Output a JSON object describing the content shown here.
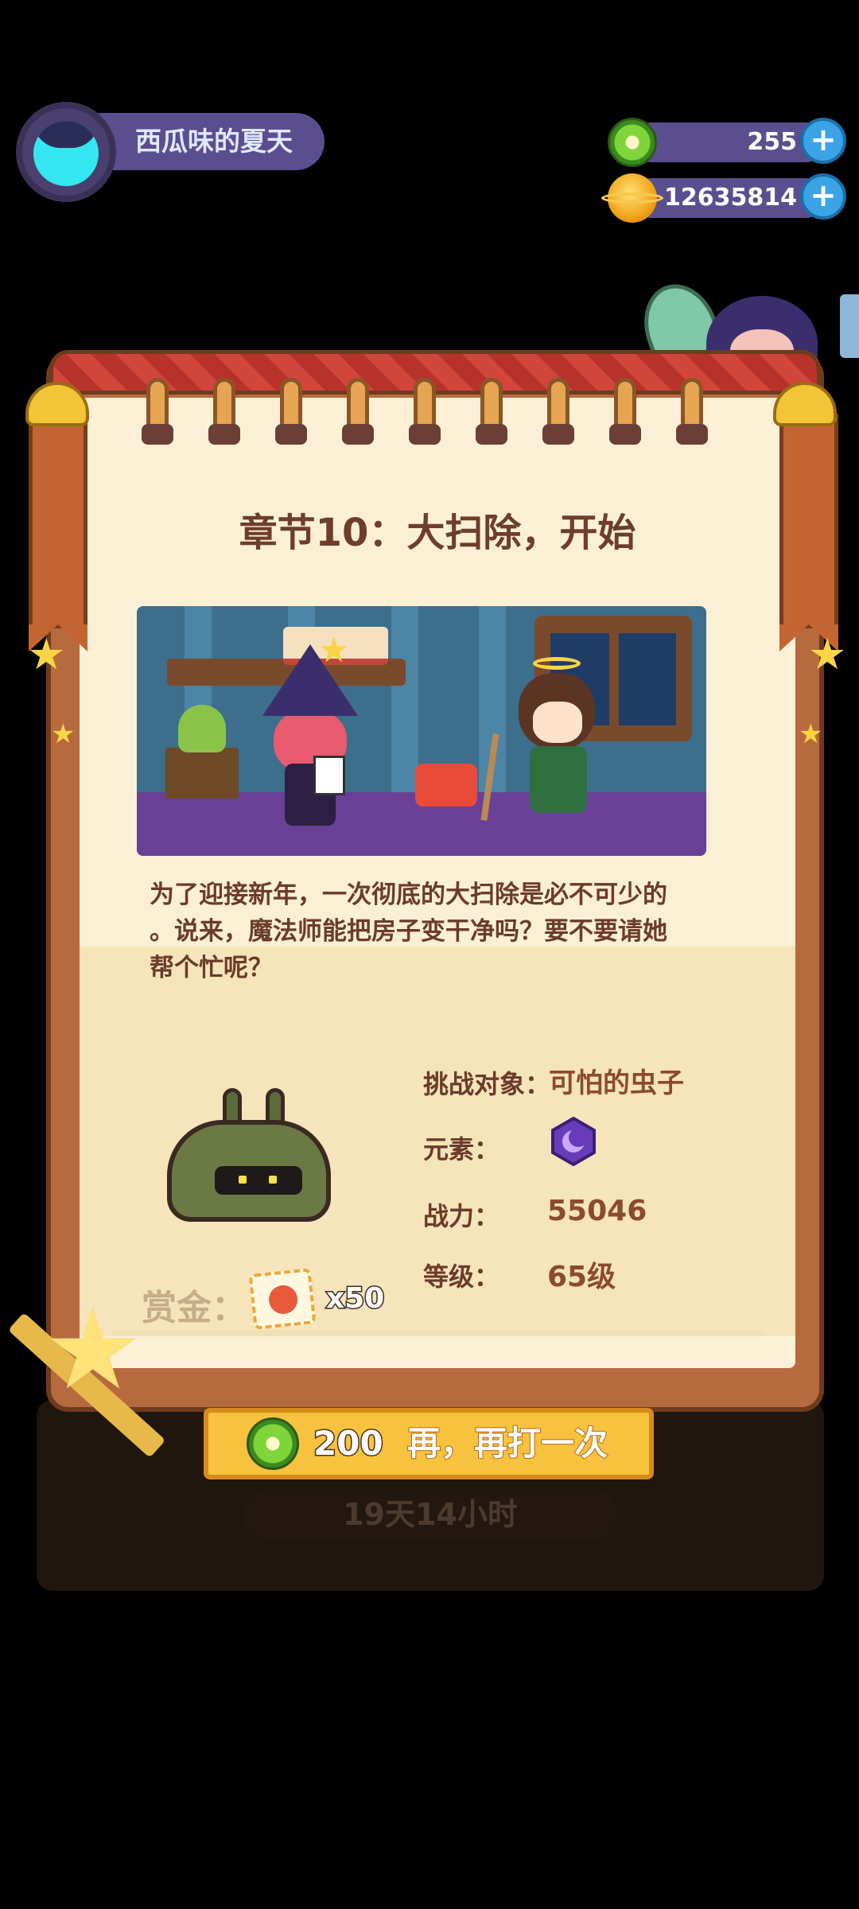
{
  "player": {
    "name": "西瓜味的夏天",
    "avatar_icon": "cat-avatar-icon"
  },
  "currencies": [
    {
      "icon": "green-ring-coin-icon",
      "value": "255"
    },
    {
      "icon": "gold-planet-coin-icon",
      "value": "12635814"
    }
  ],
  "chapter": {
    "title": "章节10：大扫除，开始",
    "description_lines": [
      "为了迎接新年，一次彻底的大扫除是必不可少的",
      "。说来，魔法师能把房子变干净吗？要不要请她",
      "帮个忙呢？"
    ]
  },
  "challenge": {
    "target_label": "挑战对象：",
    "target_value": "可怕的虫子",
    "element_label": "元素：",
    "element_icon": "purple-moon-element-icon",
    "power_label": "战力：",
    "power_value": "55046",
    "level_label": "等级：",
    "level_value": "65级"
  },
  "reward": {
    "label": "赏金：",
    "item_icon": "food-ticket-icon",
    "count": "x50"
  },
  "retry_button": {
    "cost": "200",
    "label": "再，再打一次",
    "cost_icon": "green-ring-coin-icon"
  },
  "timer": "19天14小时",
  "colors": {
    "accent": "#f7c23d",
    "frame": "#b86a3f",
    "page": "#fbf0d6",
    "text": "#6b3b2b"
  }
}
